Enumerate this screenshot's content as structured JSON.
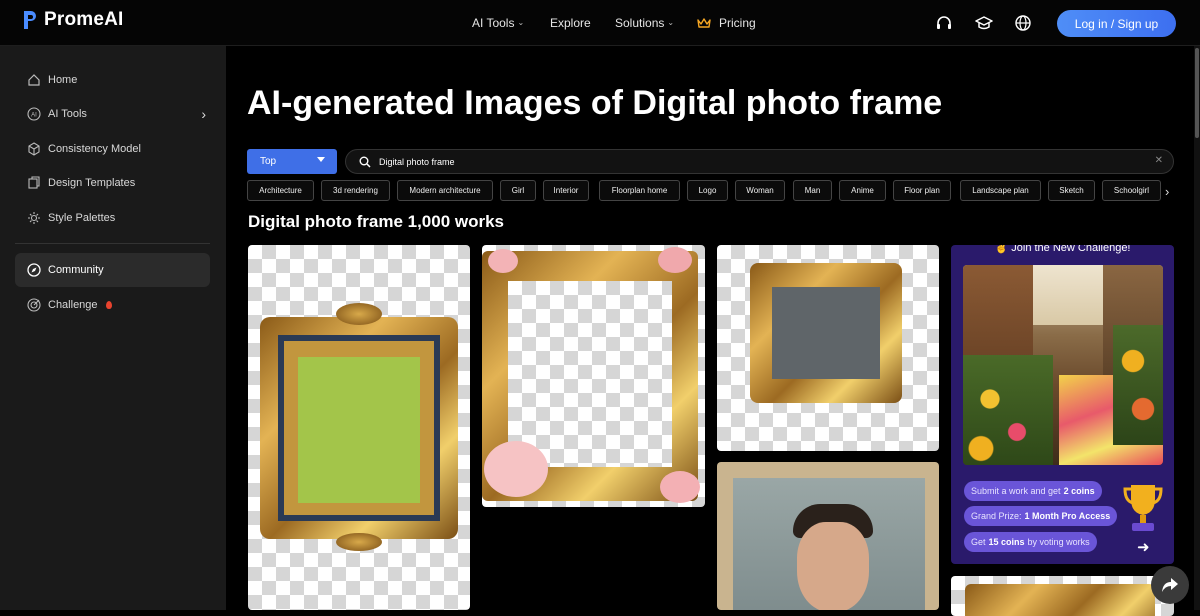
{
  "brand": {
    "name": "PromeAI",
    "accent": "#3f6fe7"
  },
  "nav": {
    "ai_tools": "AI Tools",
    "explore": "Explore",
    "solutions": "Solutions",
    "pricing": "Pricing",
    "login": "Log in / Sign up"
  },
  "sidebar": {
    "items": [
      {
        "label": "Home",
        "icon": "home-icon"
      },
      {
        "label": "AI Tools",
        "icon": "ai-icon"
      },
      {
        "label": "Consistency Model",
        "icon": "cube-icon"
      },
      {
        "label": "Design Templates",
        "icon": "template-icon"
      },
      {
        "label": "Style Palettes",
        "icon": "palette-icon"
      },
      {
        "label": "Community",
        "icon": "compass-icon"
      },
      {
        "label": "Challenge",
        "icon": "target-icon"
      }
    ]
  },
  "main": {
    "title": "AI-generated Images of Digital photo frame",
    "sort": "Top",
    "search_value": "Digital photo frame",
    "tags": [
      "Architecture",
      "3d rendering",
      "Modern architecture",
      "Girl",
      "Interior",
      "Floorplan home",
      "Logo",
      "Woman",
      "Man",
      "Anime",
      "Floor plan",
      "Landscape plan",
      "Sketch",
      "Schoolgirl"
    ],
    "section_title": "Digital photo frame 1,000 works"
  },
  "promo": {
    "heading": "✌ Join the New Challenge!",
    "line1_pre": "Submit a work and get",
    "line1_bold": "2 coins",
    "line2_pre": "Grand Prize:",
    "line2_bold": "1 Month Pro Access",
    "line3_pre": "Get",
    "line3_bold": "15 coins",
    "line3_post": "by voting works"
  }
}
